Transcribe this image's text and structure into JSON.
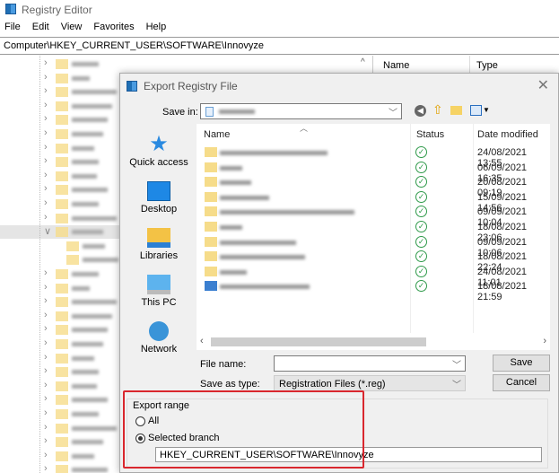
{
  "window": {
    "title": "Registry Editor"
  },
  "menu": [
    "File",
    "Edit",
    "View",
    "Favorites",
    "Help"
  ],
  "address": "Computer\\HKEY_CURRENT_USER\\SOFTWARE\\Innovyze",
  "right_pane": {
    "columns": [
      "Name",
      "Type"
    ]
  },
  "dialog": {
    "title": "Export Registry File",
    "save_in_label": "Save in:",
    "places": [
      "Quick access",
      "Desktop",
      "Libraries",
      "This PC",
      "Network"
    ],
    "columns": [
      "Name",
      "Status",
      "Date modified"
    ],
    "files": [
      {
        "type": "folder",
        "date": "24/08/2021 13:55"
      },
      {
        "type": "folder",
        "date": "06/09/2021 16:35"
      },
      {
        "type": "folder",
        "date": "20/08/2021 09:19"
      },
      {
        "type": "folder",
        "date": "15/09/2021 14:56"
      },
      {
        "type": "folder",
        "date": "09/09/2021 10:04"
      },
      {
        "type": "folder",
        "date": "18/08/2021 23:06"
      },
      {
        "type": "folder",
        "date": "09/09/2021 10:06"
      },
      {
        "type": "folder",
        "date": "18/08/2021 22:24"
      },
      {
        "type": "folder",
        "date": "24/08/2021 11:01"
      },
      {
        "type": "file",
        "date": "18/08/2021 21:59"
      }
    ],
    "file_name_label": "File name:",
    "file_name_value": "",
    "save_as_type_label": "Save as type:",
    "save_as_type_value": "Registration Files (*.reg)",
    "save_label": "Save",
    "cancel_label": "Cancel",
    "export_range": {
      "label": "Export range",
      "all_label": "All",
      "selected_label": "Selected branch",
      "selected": "selected",
      "branch_value": "HKEY_CURRENT_USER\\SOFTWARE\\Innovyze"
    }
  },
  "colors": {
    "highlight": "#d9272e",
    "status_ok": "#2f9a4a"
  }
}
